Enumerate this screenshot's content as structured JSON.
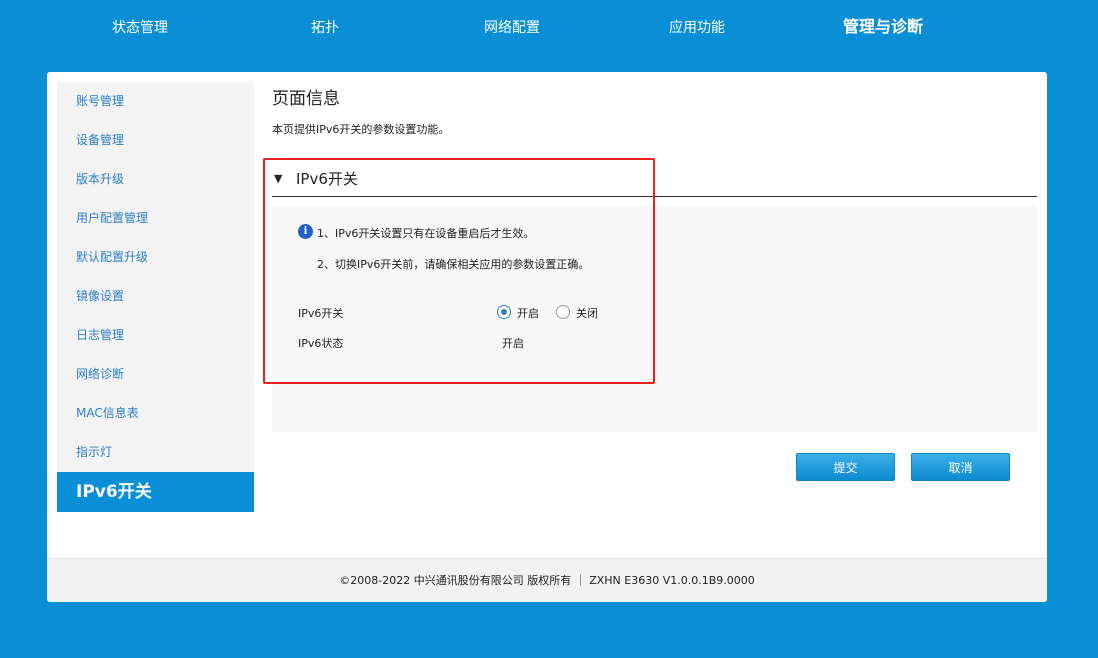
{
  "nav": {
    "items": [
      {
        "label": "状态管理"
      },
      {
        "label": "拓扑"
      },
      {
        "label": "网络配置"
      },
      {
        "label": "应用功能"
      },
      {
        "label": "管理与诊断",
        "active": true
      }
    ]
  },
  "sidebar": {
    "items": [
      {
        "label": "账号管理"
      },
      {
        "label": "设备管理"
      },
      {
        "label": "版本升级"
      },
      {
        "label": "用户配置管理"
      },
      {
        "label": "默认配置升级"
      },
      {
        "label": "镜像设置"
      },
      {
        "label": "日志管理"
      },
      {
        "label": "网络诊断"
      },
      {
        "label": "MAC信息表"
      },
      {
        "label": "指示灯"
      },
      {
        "label": "IPv6开关",
        "active": true
      }
    ]
  },
  "page": {
    "title": "页面信息",
    "description": "本页提供IPv6开关的参数设置功能。"
  },
  "section": {
    "title": "IPv6开关",
    "notes": [
      "1、IPv6开关设置只有在设备重启后才生效。",
      "2、切换IPv6开关前，请确保相关应用的参数设置正确。"
    ],
    "switch_label": "IPv6开关",
    "options": [
      {
        "label": "开启",
        "selected": true
      },
      {
        "label": "关闭",
        "selected": false
      }
    ],
    "status_label": "IPv6状态",
    "status_value": "开启"
  },
  "buttons": {
    "submit": "提交",
    "cancel": "取消"
  },
  "footer": {
    "text": "©2008-2022 中兴通讯股份有限公司 版权所有 ｜ ZXHN E3630 V1.0.0.1B9.0000"
  },
  "colors": {
    "brand": "#0a8fd6",
    "link": "#2a7fc8",
    "highlight": "#e8221c"
  },
  "icons": {
    "info": "info-icon",
    "collapse": "triangle-down-icon"
  }
}
